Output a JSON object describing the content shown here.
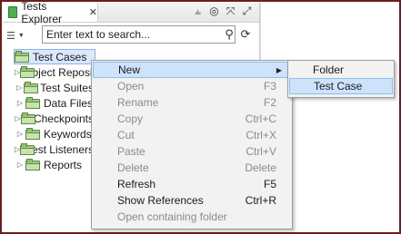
{
  "window": {
    "tab_title": "Tests Explorer",
    "tab_close": "✕",
    "toolbar_icons": [
      "pin-icon",
      "target-icon",
      "collapse-icon",
      "expand-icon"
    ]
  },
  "search": {
    "placeholder": "Enter text to search...",
    "value": ""
  },
  "tree": {
    "items": [
      {
        "label": "Test Cases",
        "selected": true
      },
      {
        "label": "Object Repository"
      },
      {
        "label": "Test Suites"
      },
      {
        "label": "Data Files"
      },
      {
        "label": "Checkpoints"
      },
      {
        "label": "Keywords"
      },
      {
        "label": "Test Listeners"
      },
      {
        "label": "Reports"
      }
    ]
  },
  "context_menu": {
    "items": [
      {
        "label": "New",
        "shortcut": "",
        "submenu": true,
        "highlight": true,
        "disabled": false
      },
      {
        "label": "Open",
        "shortcut": "F3",
        "disabled": true
      },
      {
        "label": "Rename",
        "shortcut": "F2",
        "disabled": true
      },
      {
        "label": "Copy",
        "shortcut": "Ctrl+C",
        "disabled": true
      },
      {
        "label": "Cut",
        "shortcut": "Ctrl+X",
        "disabled": true
      },
      {
        "label": "Paste",
        "shortcut": "Ctrl+V",
        "disabled": true
      },
      {
        "label": "Delete",
        "shortcut": "Delete",
        "disabled": true
      },
      {
        "label": "Refresh",
        "shortcut": "F5",
        "disabled": false
      },
      {
        "label": "Show References",
        "shortcut": "Ctrl+R",
        "disabled": false
      },
      {
        "label": "Open containing folder",
        "shortcut": "",
        "disabled": true
      }
    ]
  },
  "submenu": {
    "items": [
      {
        "label": "Folder"
      },
      {
        "label": "Test Case",
        "highlight": true
      }
    ]
  },
  "colors": {
    "highlight": "#cce3fb",
    "frame": "#6b1e1e",
    "folder_green": "#a6c98e"
  }
}
